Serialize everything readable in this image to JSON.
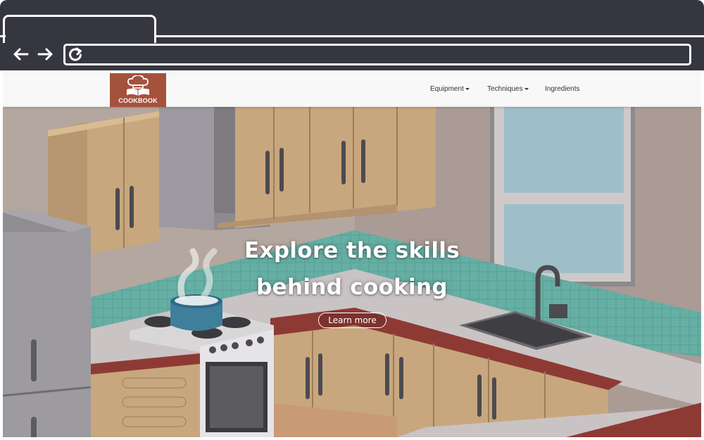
{
  "browser": {
    "back_icon": "arrow-left-icon",
    "forward_icon": "arrow-right-icon",
    "reload_icon": "reload-icon",
    "url": ""
  },
  "navbar": {
    "logo_text": "COOKBOOK",
    "logo_icon": "chef-hat-book-icon",
    "brand_color": "#a5523d",
    "menu": [
      {
        "label": "Equipment",
        "dropdown": true
      },
      {
        "label": "Techniques",
        "dropdown": true
      },
      {
        "label": "Ingredients",
        "dropdown": false
      }
    ]
  },
  "hero": {
    "title_line1": "Explore the skills",
    "title_line2": "behind cooking",
    "cta_label": "Learn more",
    "illustration": "kitchen-illustration"
  }
}
